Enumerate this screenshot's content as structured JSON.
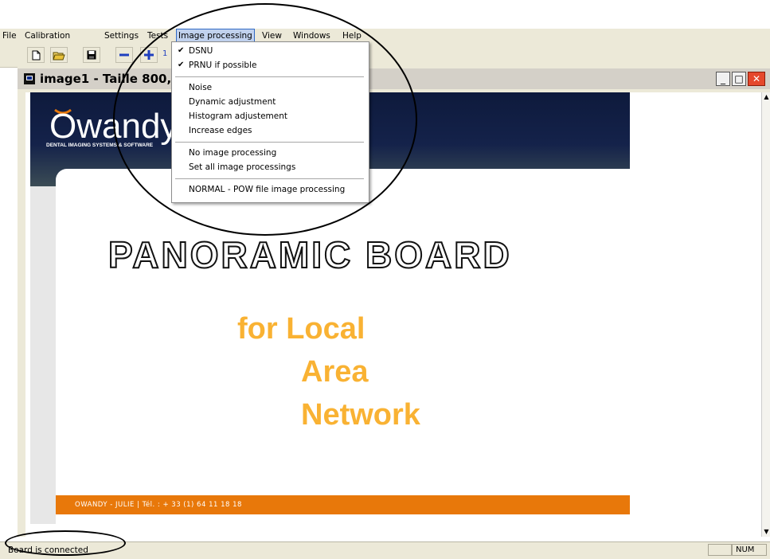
{
  "menubar": {
    "items": [
      "File",
      "Calibration",
      "Settings",
      "Tests",
      "Image processing",
      "View",
      "Windows",
      "Help"
    ],
    "active": "Image processing"
  },
  "toolbar": {
    "buttons": [
      "new-file-icon",
      "open-folder-icon",
      "save-icon",
      "zoom-out-icon",
      "zoom-in-icon"
    ],
    "partial_label": "1"
  },
  "window": {
    "title": "image1 - Taille 800, ..."
  },
  "dropdown": {
    "groups": [
      [
        {
          "label": "DSNU",
          "checked": true
        },
        {
          "label": "PRNU if possible",
          "checked": true
        }
      ],
      [
        {
          "label": "Noise"
        },
        {
          "label": "Dynamic adjustment"
        },
        {
          "label": "Histogram adjustement"
        },
        {
          "label": "Increase edges"
        }
      ],
      [
        {
          "label": "No image processing"
        },
        {
          "label": "Set all image processings"
        }
      ],
      [
        {
          "label": "NORMAL - POW file image processing"
        }
      ]
    ],
    "check_glyph": "✔"
  },
  "slide": {
    "logo_text": "Owandy",
    "logo_tagline": "DENTAL IMAGING SYSTEMS & SOFTWARE",
    "heading": "PANORAMIC BOARD",
    "sub_line1": "for Local",
    "sub_line2": "Area",
    "sub_line3": "Network",
    "footer": "OWANDY - JULIE | Tél. : + 33 (1) 64 11 18 18",
    "colors": {
      "heading": "#ffffff",
      "heading_outline": "#111111",
      "sub": "#f9b233",
      "footer_bg": "#e8780a",
      "header_bg": "#14224a"
    }
  },
  "status": {
    "text": "Board is connected",
    "num": "NUM"
  }
}
